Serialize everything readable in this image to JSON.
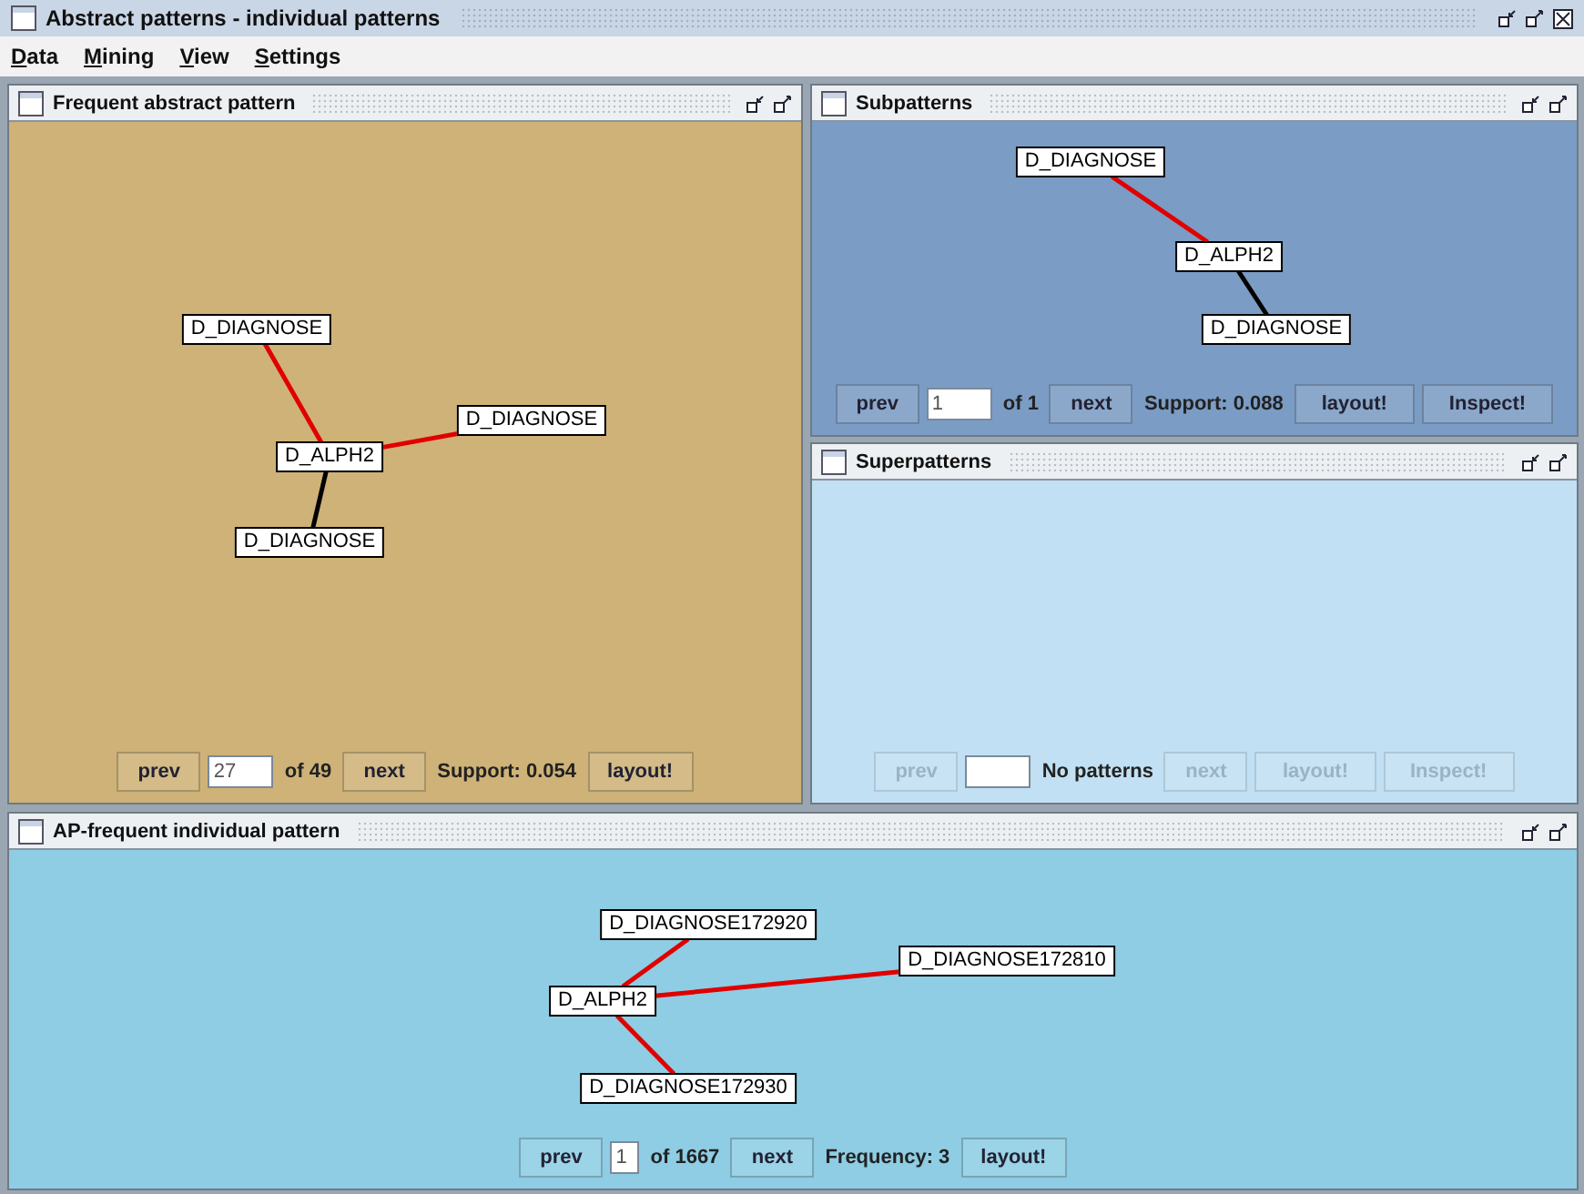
{
  "window": {
    "title": "Abstract patterns - individual patterns"
  },
  "menu": [
    {
      "label": "Data"
    },
    {
      "label": "Mining"
    },
    {
      "label": "View"
    },
    {
      "label": "Settings"
    }
  ],
  "panels": [
    {
      "title": "Frequent abstract pattern",
      "graph": {
        "label": "D_ALPH2",
        "children": [
          {
            "label": "D_DIAGNOSE",
            "color": "#e00000"
          },
          {
            "label": "D_DIAGNOSE",
            "color": "#e00000"
          },
          {
            "label": "D_DIAGNOSE",
            "color": "#000000"
          }
        ]
      },
      "controls": [
        {
          "kind": "button",
          "label": "prev",
          "disabled": false
        },
        {
          "kind": "field",
          "value": "27"
        },
        {
          "kind": "text",
          "label": "of 49"
        },
        {
          "kind": "button",
          "label": "next",
          "disabled": false
        },
        {
          "kind": "text",
          "label": "Support: 0.054"
        },
        {
          "kind": "button",
          "label": "layout!",
          "disabled": false
        }
      ]
    },
    {
      "title": "Subpatterns",
      "graph": {
        "label": "D_ALPH2",
        "children": [
          {
            "label": "D_DIAGNOSE",
            "color": "#e00000"
          },
          {
            "label": "D_DIAGNOSE",
            "color": "#000000"
          }
        ]
      },
      "controls": [
        {
          "kind": "button",
          "label": "prev",
          "disabled": false
        },
        {
          "kind": "field",
          "value": "1"
        },
        {
          "kind": "text",
          "label": "of 1"
        },
        {
          "kind": "button",
          "label": "next",
          "disabled": false
        },
        {
          "kind": "text",
          "label": "Support: 0.088"
        },
        {
          "kind": "button",
          "label": "layout!",
          "disabled": false
        },
        {
          "kind": "button",
          "label": "Inspect!",
          "disabled": false
        }
      ]
    },
    {
      "title": "Superpatterns",
      "controls": [
        {
          "kind": "button",
          "label": "prev",
          "disabled": true
        },
        {
          "kind": "field"
        },
        {
          "kind": "text",
          "label": "No patterns"
        },
        {
          "kind": "button",
          "label": "next",
          "disabled": true
        },
        {
          "kind": "button",
          "label": "layout!",
          "disabled": true
        },
        {
          "kind": "button",
          "label": "Inspect!",
          "disabled": true
        }
      ]
    },
    {
      "title": "AP-frequent individual pattern",
      "graph": {
        "label": "D_ALPH2",
        "children": [
          {
            "label": "D_DIAGNOSE172920",
            "color": "#e00000"
          },
          {
            "label": "D_DIAGNOSE172810",
            "color": "#e00000"
          },
          {
            "label": "D_DIAGNOSE172930",
            "color": "#e00000"
          }
        ]
      },
      "controls": [
        {
          "kind": "button",
          "label": "prev",
          "disabled": false
        },
        {
          "kind": "field",
          "value": "1"
        },
        {
          "kind": "text",
          "label": "of 1667"
        },
        {
          "kind": "button",
          "label": "next",
          "disabled": false
        },
        {
          "kind": "text",
          "label": "Frequency: 3"
        },
        {
          "kind": "button",
          "label": "layout!",
          "disabled": false
        }
      ]
    }
  ]
}
